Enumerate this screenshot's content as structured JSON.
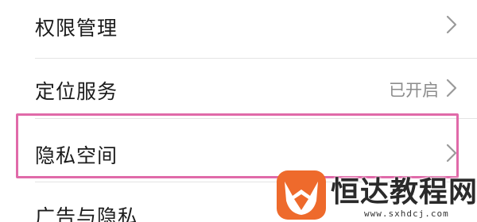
{
  "settings": {
    "items": [
      {
        "label": "权限管理",
        "value": "",
        "icon": "chevron-right-icon"
      },
      {
        "label": "定位服务",
        "value": "已开启",
        "icon": "chevron-right-icon"
      },
      {
        "label": "隐私空间",
        "value": "",
        "icon": "chevron-right-icon",
        "highlighted": true
      },
      {
        "label": "广告与隐私",
        "value": ""
      }
    ]
  },
  "highlight": {
    "color": "#e06aa9"
  },
  "watermark": {
    "title": "恒达教程网",
    "url": "www.sxhdcj.com",
    "logo_icon": "fox-icon",
    "logo_color": "#ee6a2c"
  }
}
